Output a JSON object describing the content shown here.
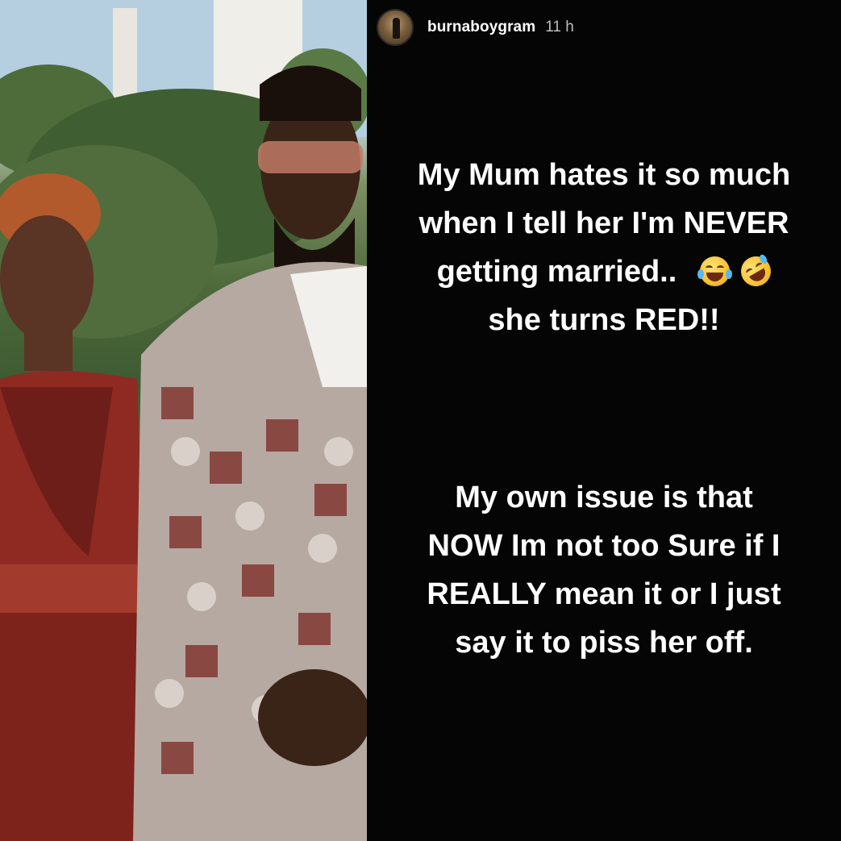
{
  "story": {
    "username": "burnaboygram",
    "time": "11 h",
    "paragraph1": {
      "line1": "My Mum hates it so much",
      "line2": "when I tell her I'm NEVER",
      "line3": "getting married..",
      "line4": "she turns RED!!"
    },
    "paragraph2": {
      "line1": "My own issue is that",
      "line2": "NOW Im not too Sure if I",
      "line3": "REALLY mean it or I just",
      "line4": "say it to piss her off."
    },
    "emojis": [
      "tears-of-joy-emoji",
      "rolling-on-floor-laughing-emoji"
    ]
  },
  "colors": {
    "story_background": "#050505",
    "text": "#ffffff",
    "timestamp": "#bdbdbd",
    "dress_red": "#8e2a22",
    "suit_pattern": "#b6a9a2"
  }
}
